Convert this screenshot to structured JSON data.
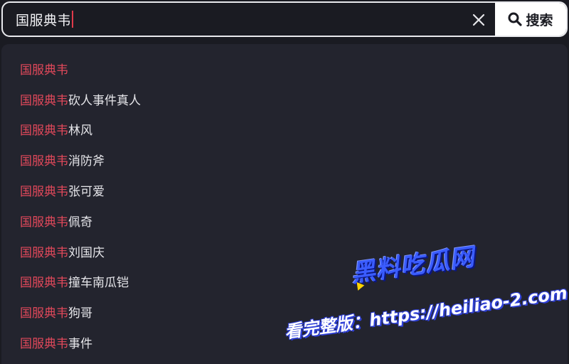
{
  "search": {
    "query": "国服典韦",
    "button_label": "搜索",
    "clear_icon": "close-icon",
    "search_icon": "magnifier-icon"
  },
  "colors": {
    "background": "#1a1b22",
    "dropdown": "#23242e",
    "highlight": "#e0485a",
    "text": "#e6e6ea",
    "caret": "#e03a4a"
  },
  "suggestions": [
    {
      "match": "国服典韦",
      "rest": ""
    },
    {
      "match": "国服典韦",
      "rest": "砍人事件真人"
    },
    {
      "match": "国服典韦",
      "rest": "林风"
    },
    {
      "match": "国服典韦",
      "rest": "消防斧"
    },
    {
      "match": "国服典韦",
      "rest": "张可爱"
    },
    {
      "match": "国服典韦",
      "rest": "佩奇"
    },
    {
      "match": "国服典韦",
      "rest": "刘国庆"
    },
    {
      "match": "国服典韦",
      "rest": "撞车南瓜铠"
    },
    {
      "match": "国服典韦",
      "rest": "狗哥"
    },
    {
      "match": "国服典韦",
      "rest": "事件"
    }
  ],
  "watermark": {
    "logo": "黑料吃瓜网",
    "url": "看完整版：https://heiliao-2.com"
  }
}
